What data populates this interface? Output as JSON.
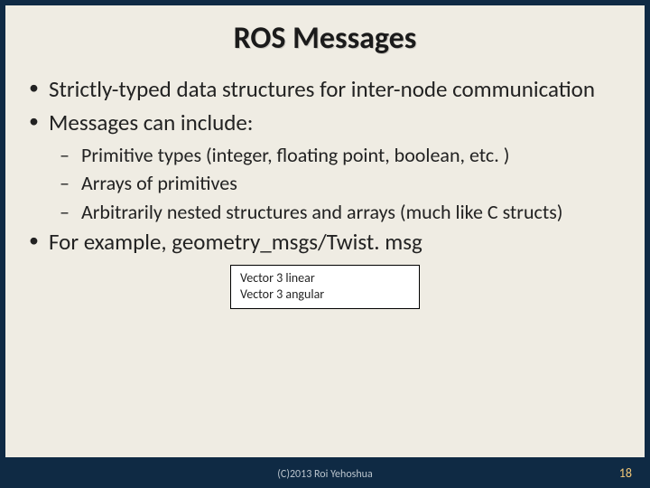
{
  "title": "ROS Messages",
  "bullets": {
    "b1": "Strictly-typed data structures for inter-node communication",
    "b2": "Messages can include:",
    "s1": "Primitive types (integer, floating point, boolean, etc. )",
    "s2": "Arrays of primitives",
    "s3": "Arbitrarily nested structures and arrays (much like C structs)",
    "b3": "For example, geometry_msgs/Twist. msg"
  },
  "codebox": {
    "line1": "Vector 3 linear",
    "line2": "Vector 3 angular"
  },
  "footer": {
    "copyright": "(C)2013 Roi Yehoshua",
    "page": "18"
  }
}
